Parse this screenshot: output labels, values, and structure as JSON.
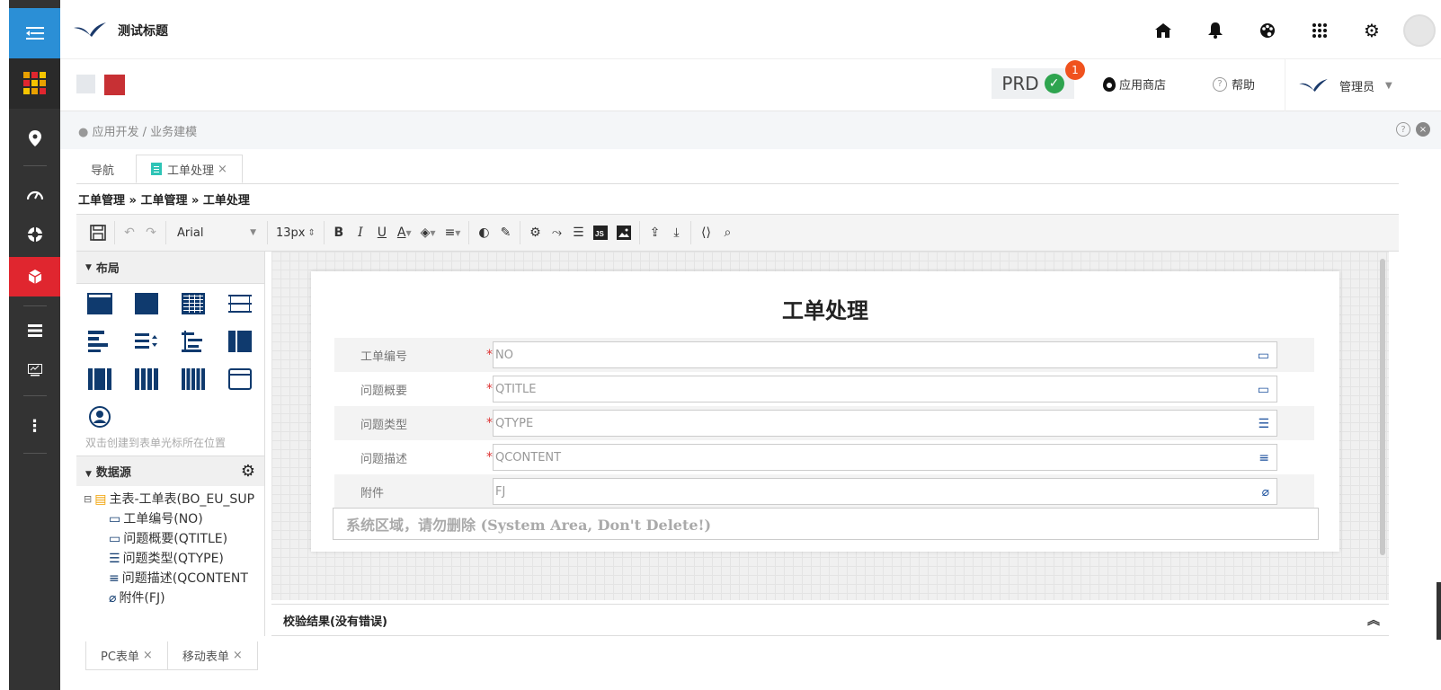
{
  "header": {
    "title": "测试标题"
  },
  "top_icons": [
    "home-icon",
    "bell-icon",
    "palette-icon",
    "grid-dots-icon",
    "gear-icon",
    "user-avatar"
  ],
  "subbar": {
    "env": "PRD",
    "env_badge": "1",
    "app_store": "应用商店",
    "help": "帮助",
    "user": "管理员",
    "colors": {
      "swatch_light": "#e5e8ec",
      "swatch_red": "#c73034"
    }
  },
  "breadcrumb": "应用开发 / 业务建模",
  "tabs": [
    {
      "label": "导航"
    },
    {
      "label": "工单处理",
      "closable": true
    }
  ],
  "path": "工单管理 » 工单管理 » 工单处理",
  "toolbar": {
    "font": "Arial",
    "size": "13px"
  },
  "palette": {
    "layout_title": "布局",
    "hint": "双击创建到表单光标所在位置",
    "datasource_title": "数据源",
    "tree_root": "主表-工单表(BO_EU_SUP",
    "tree_children": [
      "工单编号(NO)",
      "问题概要(QTITLE)",
      "问题类型(QTYPE)",
      "问题描述(QCONTENT",
      "附件(FJ)"
    ]
  },
  "form": {
    "title": "工单处理",
    "rows": [
      {
        "label": "工单编号",
        "required": "*",
        "value": "NO"
      },
      {
        "label": "问题概要",
        "required": "*",
        "value": "QTITLE"
      },
      {
        "label": "问题类型",
        "required": "*",
        "value": "QTYPE"
      },
      {
        "label": "问题描述",
        "required": "*",
        "value": "QCONTENT"
      },
      {
        "label": "附件",
        "required": "",
        "value": "FJ"
      }
    ],
    "system_area": "系统区域，请勿删除 (System Area, Don't Delete!)"
  },
  "validation": "校验结果(没有错误)",
  "bottom_tabs": [
    "PC表单",
    "移动表单"
  ]
}
